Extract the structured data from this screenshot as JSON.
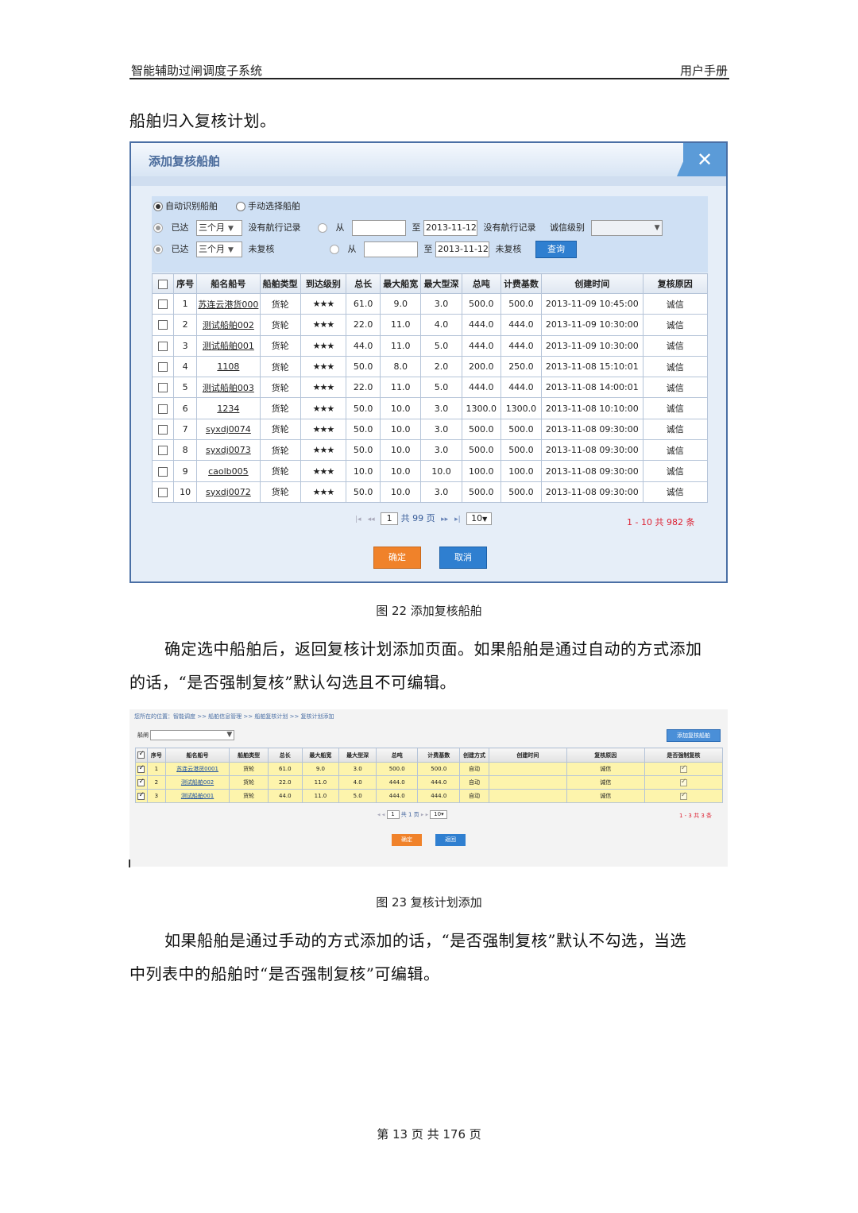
{
  "header": {
    "left": "智能辅助过闸调度子系统",
    "right": "用户手册"
  },
  "intro_text": "船舶归入复核计划。",
  "dialog": {
    "title": "添加复核船舶",
    "close_glyph": "✕",
    "mode_auto": "自动识别船舶",
    "mode_manual": "手动选择船舶",
    "row1": {
      "arrived": "已达",
      "period": "三个月",
      "no_record": "没有航行记录",
      "from": "从",
      "to": "至",
      "to_date": "2013-11-12",
      "no_record2": "没有航行记录",
      "credit_label": "诚信级别",
      "credit_value": ""
    },
    "row2": {
      "arrived": "已达",
      "period": "三个月",
      "unreviewed": "未复核",
      "from": "从",
      "to": "至",
      "to_date": "2013-11-12",
      "unreviewed2": "未复核",
      "query": "查询"
    },
    "columns": [
      "序号",
      "船名船号",
      "船舶类型",
      "到达级别",
      "总长",
      "最大船宽",
      "最大型深",
      "总吨",
      "计费基数",
      "创建时间",
      "复核原因"
    ],
    "rows": [
      [
        "1",
        "苏连云港货000",
        "货轮",
        "★★★",
        "61.0",
        "9.0",
        "3.0",
        "500.0",
        "500.0",
        "2013-11-09 10:45:00",
        "诚信"
      ],
      [
        "2",
        "测试船舶002",
        "货轮",
        "★★★",
        "22.0",
        "11.0",
        "4.0",
        "444.0",
        "444.0",
        "2013-11-09 10:30:00",
        "诚信"
      ],
      [
        "3",
        "测试船舶001",
        "货轮",
        "★★★",
        "44.0",
        "11.0",
        "5.0",
        "444.0",
        "444.0",
        "2013-11-09 10:30:00",
        "诚信"
      ],
      [
        "4",
        "1108",
        "货轮",
        "★★★",
        "50.0",
        "8.0",
        "2.0",
        "200.0",
        "250.0",
        "2013-11-08 15:10:01",
        "诚信"
      ],
      [
        "5",
        "测试船舶003",
        "货轮",
        "★★★",
        "22.0",
        "11.0",
        "5.0",
        "444.0",
        "444.0",
        "2013-11-08 14:00:01",
        "诚信"
      ],
      [
        "6",
        "1234",
        "货轮",
        "★★★",
        "50.0",
        "10.0",
        "3.0",
        "1300.0",
        "1300.0",
        "2013-11-08 10:10:00",
        "诚信"
      ],
      [
        "7",
        "syxdj0074",
        "货轮",
        "★★★",
        "50.0",
        "10.0",
        "3.0",
        "500.0",
        "500.0",
        "2013-11-08 09:30:00",
        "诚信"
      ],
      [
        "8",
        "syxdj0073",
        "货轮",
        "★★★",
        "50.0",
        "10.0",
        "3.0",
        "500.0",
        "500.0",
        "2013-11-08 09:30:00",
        "诚信"
      ],
      [
        "9",
        "caolb005",
        "货轮",
        "★★★",
        "10.0",
        "10.0",
        "10.0",
        "100.0",
        "100.0",
        "2013-11-08 09:30:00",
        "诚信"
      ],
      [
        "10",
        "syxdj0072",
        "货轮",
        "★★★",
        "50.0",
        "10.0",
        "3.0",
        "500.0",
        "500.0",
        "2013-11-08 09:30:00",
        "诚信"
      ]
    ],
    "pager": {
      "page": "1",
      "total_pages": "共 99 页",
      "page_size": "10",
      "count": "1 - 10  共 982 条"
    },
    "ok": "确定",
    "cancel": "取消"
  },
  "caption22": "图 22 添加复核船舶",
  "para2_line1": "确定选中船舶后，返回复核计划添加页面。如果船舶是通过自动的方式添加",
  "para2_line2": "的话，“是否强制复核”默认勾选且不可编辑。",
  "fig23": {
    "breadcrumb": "您所在的位置：智能调度 >> 船舶信息管理 >> 船舶复核计划 >> 复核计划添加",
    "lock_label": "船闸",
    "add_button": "添加复核船舶",
    "columns": [
      "序号",
      "船名船号",
      "船舶类型",
      "总长",
      "最大船宽",
      "最大型深",
      "总吨",
      "计费基数",
      "创建方式",
      "创建时间",
      "复核原因",
      "是否强制复核"
    ],
    "rows": [
      [
        "1",
        "苏连云港货0001",
        "货轮",
        "61.0",
        "9.0",
        "3.0",
        "500.0",
        "500.0",
        "自动",
        "",
        "诚信"
      ],
      [
        "2",
        "测试船舶002",
        "货轮",
        "22.0",
        "11.0",
        "4.0",
        "444.0",
        "444.0",
        "自动",
        "",
        "诚信"
      ],
      [
        "3",
        "测试船舶001",
        "货轮",
        "44.0",
        "11.0",
        "5.0",
        "444.0",
        "444.0",
        "自动",
        "",
        "诚信"
      ]
    ],
    "pager": {
      "page": "1",
      "total_pages": "共 1 页",
      "page_size": "10",
      "count": "1 - 3  共 3 条"
    },
    "ok": "确定",
    "back": "返回"
  },
  "caption23": "图 23 复核计划添加",
  "para3_line1": "如果船舶是通过手动的方式添加的话，“是否强制复核”默认不勾选，当选",
  "para3_line2": "中列表中的船舶时“是否强制复核”可编辑。",
  "footer": "第 13 页 共 176 页",
  "colors": {
    "accent_blue": "#2f7fd0",
    "orange": "#f0822a",
    "row_yellow": "#fdf4ac",
    "link": "#1a4ea0",
    "count_red": "#dd2233"
  }
}
